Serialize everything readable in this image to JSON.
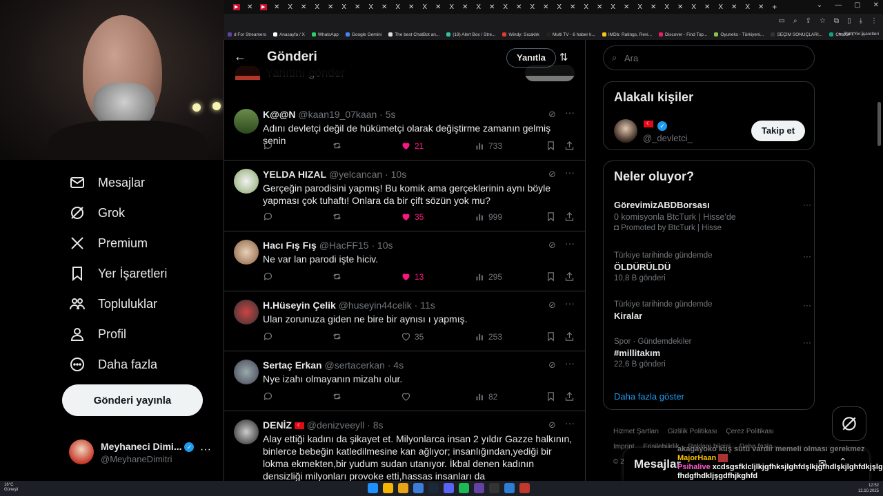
{
  "browser": {
    "bookmarks": [
      "d For Streamers",
      "Anasayfa / X",
      "WhatsApp",
      "Google Gemini",
      "The best ChatBot an...",
      "(19) Alert Box / Stre...",
      "Windy: Sıcaklık",
      "Multi TV - 6 haber k...",
      "IMDb: Ratings, Revi...",
      "Discover - Find Top...",
      "Oyuneks - Türkiyeni...",
      "SEÇİM SONUÇLARI...",
      "ChatGPT"
    ],
    "bookmarks_overflow": "»",
    "all_bookmarks": "Tüm Yer İşaretleri"
  },
  "nav": {
    "messages": "Mesajlar",
    "grok": "Grok",
    "premium": "Premium",
    "bookmarks": "Yer İşaretleri",
    "communities": "Topluluklar",
    "profile": "Profil",
    "more": "Daha fazla",
    "post_button": "Gönderi yayınla",
    "account_name": "Meyhaneci Dimi...",
    "account_handle": "@MeyhaneDimitri"
  },
  "header": {
    "title": "Gönderi",
    "reply_button": "Yanıtla",
    "ghost_placeholder": "Yanıtını gönder"
  },
  "tweets": [
    {
      "name": "K@@N",
      "handle": "@kaan19_07kaan · 5s",
      "text": "Adını devletçi değil de hükümetçi olarak değiştirme zamanın gelmiş senin",
      "likes": "21",
      "views": "733",
      "liked": true
    },
    {
      "name": "YELDA HIZAL",
      "handle": "@yelcancan · 10s",
      "text": "Gerçeğin parodisini yapmış! Bu komik ama gerçeklerinin aynı böyle yapması çok tuhaftı! Onlara da bir çift sözün yok mu?",
      "likes": "35",
      "views": "999",
      "liked": true
    },
    {
      "name": "Hacı Fış Fış",
      "handle": "@HacFF15 · 10s",
      "text": "Ne var lan parodi işte hiciv.",
      "likes": "13",
      "views": "295",
      "liked": true
    },
    {
      "name": "H.Hüseyin Çelik",
      "handle": "@huseyin44celik · 11s",
      "text": "Ulan zorunuza giden ne bire bir aynısı ı yapmış.",
      "likes": "35",
      "views": "253",
      "liked": false
    },
    {
      "name": "Sertaç Erkan",
      "handle": "@sertacerkan · 4s",
      "text": "Nye izahı olmayanın mizahı olur.",
      "likes": "",
      "views": "82",
      "liked": false
    },
    {
      "name": "DENİZ",
      "handle": "@denizveeyll · 8s",
      "text": "Alay ettiği kadını da şikayet et. Milyonlarca insan 2 yıldır Gazze halkının, binlerce bebeğin katledilmesine kan ağlıyor; insanlığından,yediği bir lokma ekmekten,bir yudum sudan utanıyor. İkbal denen kadının densizliği milyonları provoke etti,hassas insanları da",
      "likes": "",
      "views": "",
      "liked": false
    }
  ],
  "right": {
    "search_placeholder": "Ara",
    "related_title": "Alakalı kişiler",
    "related_handle": "@_devletci_",
    "follow_button": "Takip et",
    "trends_title": "Neler oluyor?",
    "trends": [
      {
        "context": "",
        "title": "GörevimizABDBorsası",
        "sub": "0 komisyonla BtcTurk | Hisse'de",
        "promo": "Promoted by BtcTurk | Hisse"
      },
      {
        "context": "Türkiye tarihinde gündemde",
        "title": "ÖLDÜRÜLDÜ",
        "sub": "10,8 B gönderi"
      },
      {
        "context": "Türkiye tarihinde gündemde",
        "title": "Kiralar",
        "sub": ""
      },
      {
        "context": "Spor · Gündemdekiler",
        "title": "#millitakım",
        "sub": "22,6 B gönderi"
      }
    ],
    "show_more": "Daha fazla göster",
    "footer": [
      "Hizmet Şartları",
      "Gizlilik Politikası",
      "Çerez Politikası",
      "Imprint",
      "Erişilebilirlik",
      "Reklam bilgisi",
      "Daha fazla ···",
      "© 2"
    ]
  },
  "messages_drawer": {
    "title": "Mesajlar"
  },
  "stream_chat": [
    {
      "user": "akagayoko",
      "msg": "kuş sütü vardır memeli olması gerekmez"
    },
    {
      "user": "MajorHaan",
      "msg": ""
    },
    {
      "user": "Psihalive",
      "msg": "xcdsgsfklcljlkjgfhksjlghfdşlkjgfhdlşkjlghfdkjşlgfhdgfhdkljşgdfhjkghfd"
    }
  ],
  "taskbar": {
    "weather_temp": "16°C",
    "weather_desc": "Güneşli",
    "time": "12:52",
    "date": "12.10.2025"
  }
}
